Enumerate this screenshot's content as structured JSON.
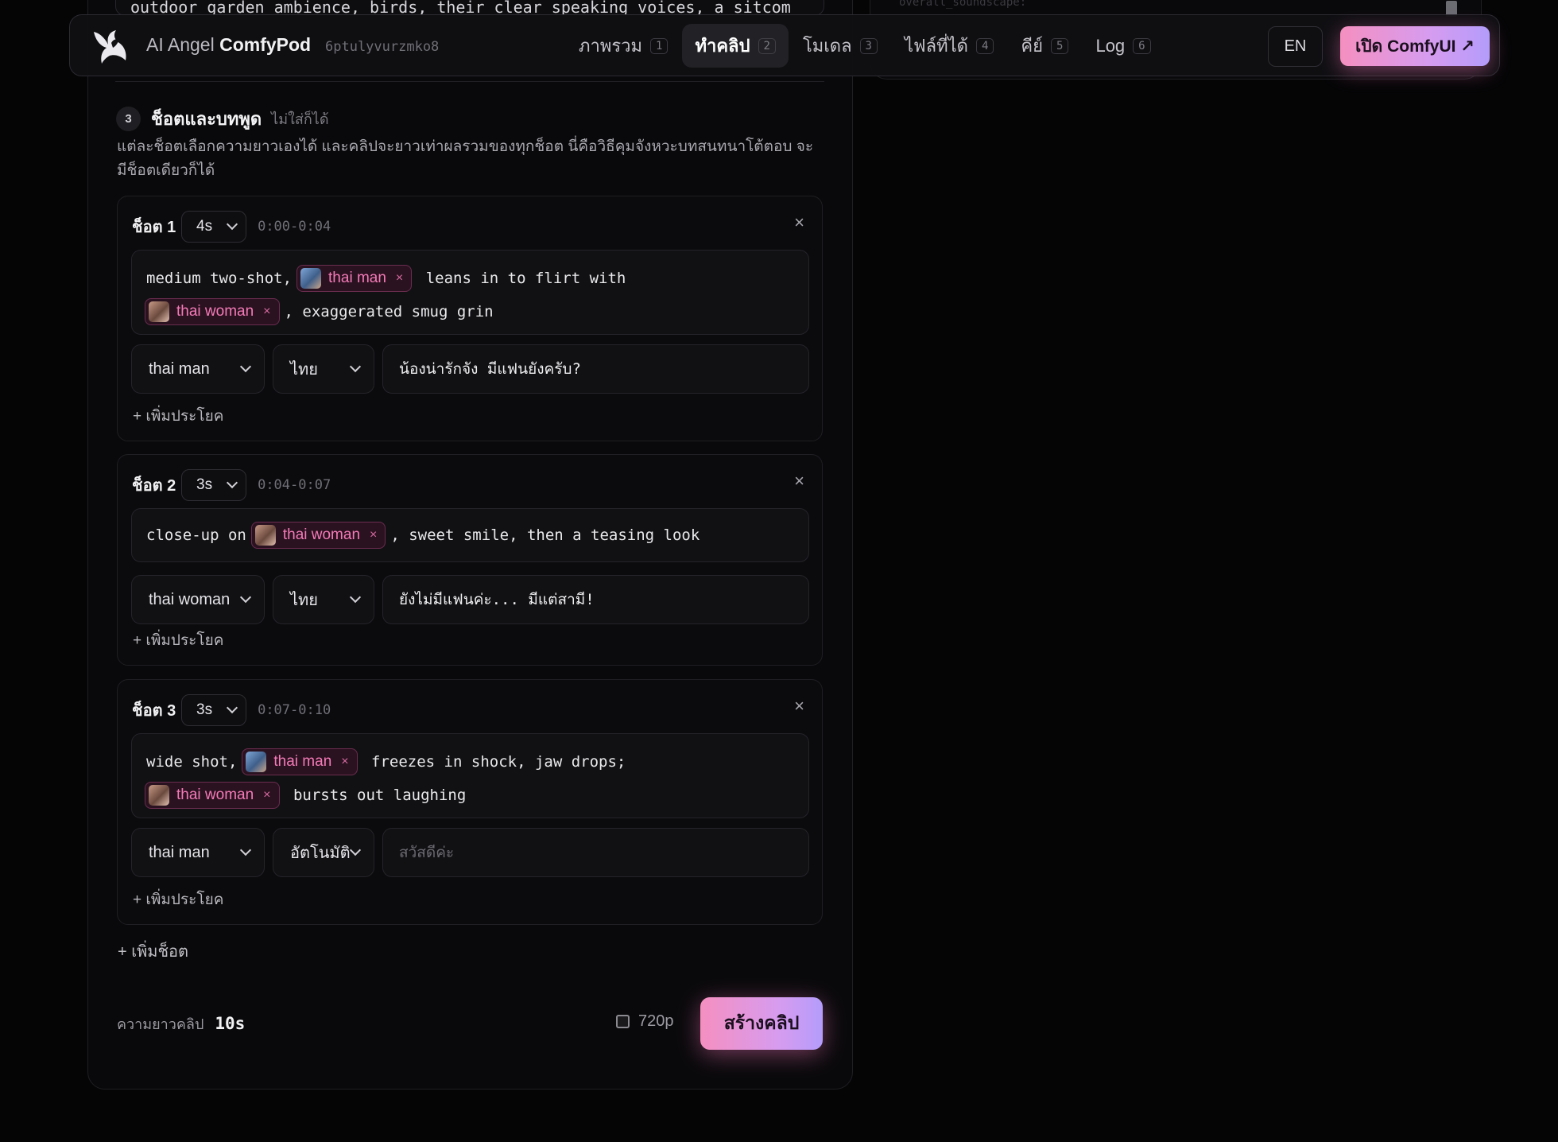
{
  "background": {
    "top_box_text": "outdoor garden ambience, birds, their clear speaking voices, a sitcom",
    "right_ghost_1": "overall_soundscape:",
    "right_ghost_2": ""
  },
  "nav": {
    "brand_light": "AI Angel ",
    "brand_bold": "ComfyPod",
    "brand_id": "6ptulyvurzmko8",
    "tabs": [
      {
        "label": "ภาพรวม",
        "num": "1"
      },
      {
        "label": "ทำคลิป",
        "num": "2"
      },
      {
        "label": "โมเดล",
        "num": "3"
      },
      {
        "label": "ไฟล์ที่ได้",
        "num": "4"
      },
      {
        "label": "คีย์",
        "num": "5"
      },
      {
        "label": "Log",
        "num": "6"
      }
    ],
    "lang_button": "EN",
    "open_button": "เปิด ComfyUI ↗",
    "colors": {
      "accent_start": "#f58fc0",
      "accent_end": "#b49cfb"
    }
  },
  "section": {
    "step": "3",
    "title": "ช็อตและบทพูด",
    "optional": "ไม่ใส่ก็ได้",
    "description": "แต่ละช็อตเลือกความยาวเองได้ และคลิปจะยาวเท่าผลรวมของทุกช็อต นี่คือวิธีคุมจังหวะบทสนทนาโต้ตอบ จะมีช็อตเดียวก็ได้"
  },
  "shots": [
    {
      "label": "ช็อต 1",
      "duration": "4s",
      "time_range": "0:00-0:04",
      "close": "×",
      "prompt": {
        "line1_pre": "medium two-shot,",
        "chip1": "thai man",
        "line1_post": " leans in to flirt with",
        "chip2": "thai woman",
        "line2_post": ", exaggerated smug grin"
      },
      "speaker": "thai man",
      "language": "ไทย",
      "line_text": "น้องน่ารักจัง มีแฟนยังครับ?",
      "add_line": "+ เพิ่มประโยค"
    },
    {
      "label": "ช็อต 2",
      "duration": "3s",
      "time_range": "0:04-0:07",
      "close": "×",
      "prompt": {
        "line1_pre": "close-up on",
        "chip1": "thai woman",
        "line1_post": ", sweet smile, then a teasing look"
      },
      "speaker": "thai woman",
      "language": "ไทย",
      "line_text": "ยังไม่มีแฟนค่ะ... มีแต่สามี!",
      "add_line": "+ เพิ่มประโยค"
    },
    {
      "label": "ช็อต 3",
      "duration": "3s",
      "time_range": "0:07-0:10",
      "close": "×",
      "prompt": {
        "line1_pre": "wide shot,",
        "chip1": "thai man",
        "line1_post": " freezes in shock, jaw drops;",
        "chip2": "thai woman",
        "line2_post": " bursts out laughing"
      },
      "speaker": "thai man",
      "language": "อัตโนมัติ",
      "line_placeholder": "สวัสดีค่ะ",
      "add_line": "+ เพิ่มประโยค"
    }
  ],
  "footer": {
    "add_shot": "+ เพิ่มช็อต",
    "length_label": "ความยาวคลิป",
    "length_value": "10s",
    "resolution_label": "720p",
    "resolution_checked": false,
    "create_button": "สร้างคลิป"
  }
}
